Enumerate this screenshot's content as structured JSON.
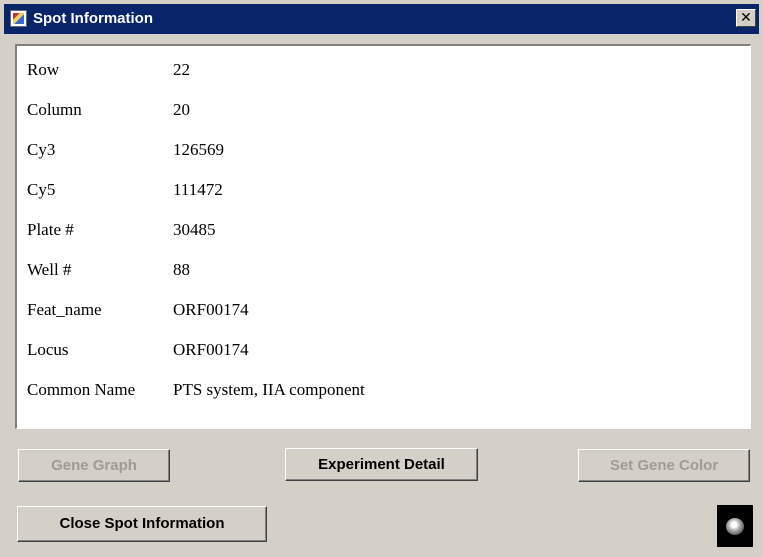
{
  "window": {
    "title": "Spot Information",
    "close_glyph": "✕"
  },
  "info": [
    {
      "label": "Row",
      "value": "22"
    },
    {
      "label": "Column",
      "value": "20"
    },
    {
      "label": "Cy3",
      "value": "126569"
    },
    {
      "label": "Cy5",
      "value": "111472"
    },
    {
      "label": "Plate #",
      "value": "30485"
    },
    {
      "label": "Well #",
      "value": "88"
    },
    {
      "label": "Feat_name",
      "value": "ORF00174"
    },
    {
      "label": "Locus",
      "value": "ORF00174"
    },
    {
      "label": "Common Name",
      "value": "PTS system, IIA component"
    }
  ],
  "buttons": {
    "gene_graph": "Gene Graph",
    "experiment_detail": "Experiment Detail",
    "set_gene_color": "Set Gene Color",
    "close_spot_information": "Close Spot Information"
  },
  "icons": {
    "app_icon": "java-app-icon",
    "corner_logo": "rotating-logo-icon"
  }
}
